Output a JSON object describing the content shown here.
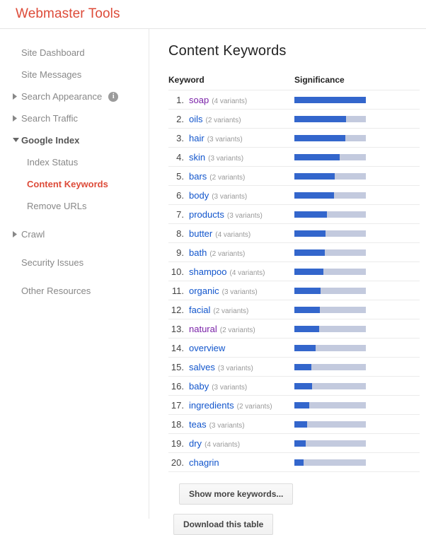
{
  "header": {
    "brand_title": "Webmaster Tools",
    "brand_color": "#dd4b39"
  },
  "sidebar": {
    "items": [
      {
        "label": "Site Dashboard",
        "type": "plain",
        "caret": "none"
      },
      {
        "label": "Site Messages",
        "type": "plain",
        "caret": "none"
      },
      {
        "label": "Search Appearance",
        "type": "group",
        "caret": "right",
        "info_icon": "info-icon",
        "info_glyph": "i"
      },
      {
        "label": "Search Traffic",
        "type": "group",
        "caret": "right"
      },
      {
        "label": "Google Index",
        "type": "group-open",
        "caret": "down"
      },
      {
        "label": "Index Status",
        "type": "child",
        "caret": "none"
      },
      {
        "label": "Content Keywords",
        "type": "child-selected",
        "caret": "none"
      },
      {
        "label": "Remove URLs",
        "type": "child",
        "caret": "none"
      },
      {
        "label": "Crawl",
        "type": "group",
        "caret": "right"
      },
      {
        "label": "Security Issues",
        "type": "plain",
        "caret": "none"
      },
      {
        "label": "Other Resources",
        "type": "plain",
        "caret": "none"
      }
    ]
  },
  "main": {
    "page_title": "Content Keywords",
    "table": {
      "columns": [
        "Keyword",
        "Significance"
      ],
      "rows": [
        {
          "rank": "1.",
          "keyword": "soap",
          "variants": "(4 variants)",
          "visited": true,
          "significance": 100
        },
        {
          "rank": "2.",
          "keyword": "oils",
          "variants": "(2 variants)",
          "visited": false,
          "significance": 72
        },
        {
          "rank": "3.",
          "keyword": "hair",
          "variants": "(3 variants)",
          "visited": false,
          "significance": 71
        },
        {
          "rank": "4.",
          "keyword": "skin",
          "variants": "(3 variants)",
          "visited": false,
          "significance": 63
        },
        {
          "rank": "5.",
          "keyword": "bars",
          "variants": "(2 variants)",
          "visited": false,
          "significance": 56
        },
        {
          "rank": "6.",
          "keyword": "body",
          "variants": "(3 variants)",
          "visited": false,
          "significance": 55
        },
        {
          "rank": "7.",
          "keyword": "products",
          "variants": "(3 variants)",
          "visited": false,
          "significance": 46
        },
        {
          "rank": "8.",
          "keyword": "butter",
          "variants": "(4 variants)",
          "visited": false,
          "significance": 44
        },
        {
          "rank": "9.",
          "keyword": "bath",
          "variants": "(2 variants)",
          "visited": false,
          "significance": 43
        },
        {
          "rank": "10.",
          "keyword": "shampoo",
          "variants": "(4 variants)",
          "visited": false,
          "significance": 41
        },
        {
          "rank": "11.",
          "keyword": "organic",
          "variants": "(3 variants)",
          "visited": false,
          "significance": 37
        },
        {
          "rank": "12.",
          "keyword": "facial",
          "variants": "(2 variants)",
          "visited": false,
          "significance": 36
        },
        {
          "rank": "13.",
          "keyword": "natural",
          "variants": "(2 variants)",
          "visited": true,
          "significance": 35
        },
        {
          "rank": "14.",
          "keyword": "overview",
          "variants": "",
          "visited": false,
          "significance": 30
        },
        {
          "rank": "15.",
          "keyword": "salves",
          "variants": "(3 variants)",
          "visited": false,
          "significance": 24
        },
        {
          "rank": "16.",
          "keyword": "baby",
          "variants": "(3 variants)",
          "visited": false,
          "significance": 25
        },
        {
          "rank": "17.",
          "keyword": "ingredients",
          "variants": "(2 variants)",
          "visited": false,
          "significance": 21
        },
        {
          "rank": "18.",
          "keyword": "teas",
          "variants": "(3 variants)",
          "visited": false,
          "significance": 18
        },
        {
          "rank": "19.",
          "keyword": "dry",
          "variants": "(4 variants)",
          "visited": false,
          "significance": 16
        },
        {
          "rank": "20.",
          "keyword": "chagrin",
          "variants": "",
          "visited": false,
          "significance": 13
        }
      ]
    },
    "buttons": {
      "show_more": "Show more keywords...",
      "download": "Download this table"
    }
  },
  "colors": {
    "bar_fill": "#3366cc",
    "bar_track": "#c3cade",
    "link": "#1155cc",
    "link_visited": "#7a22a8",
    "accent_red": "#dd4b39"
  }
}
